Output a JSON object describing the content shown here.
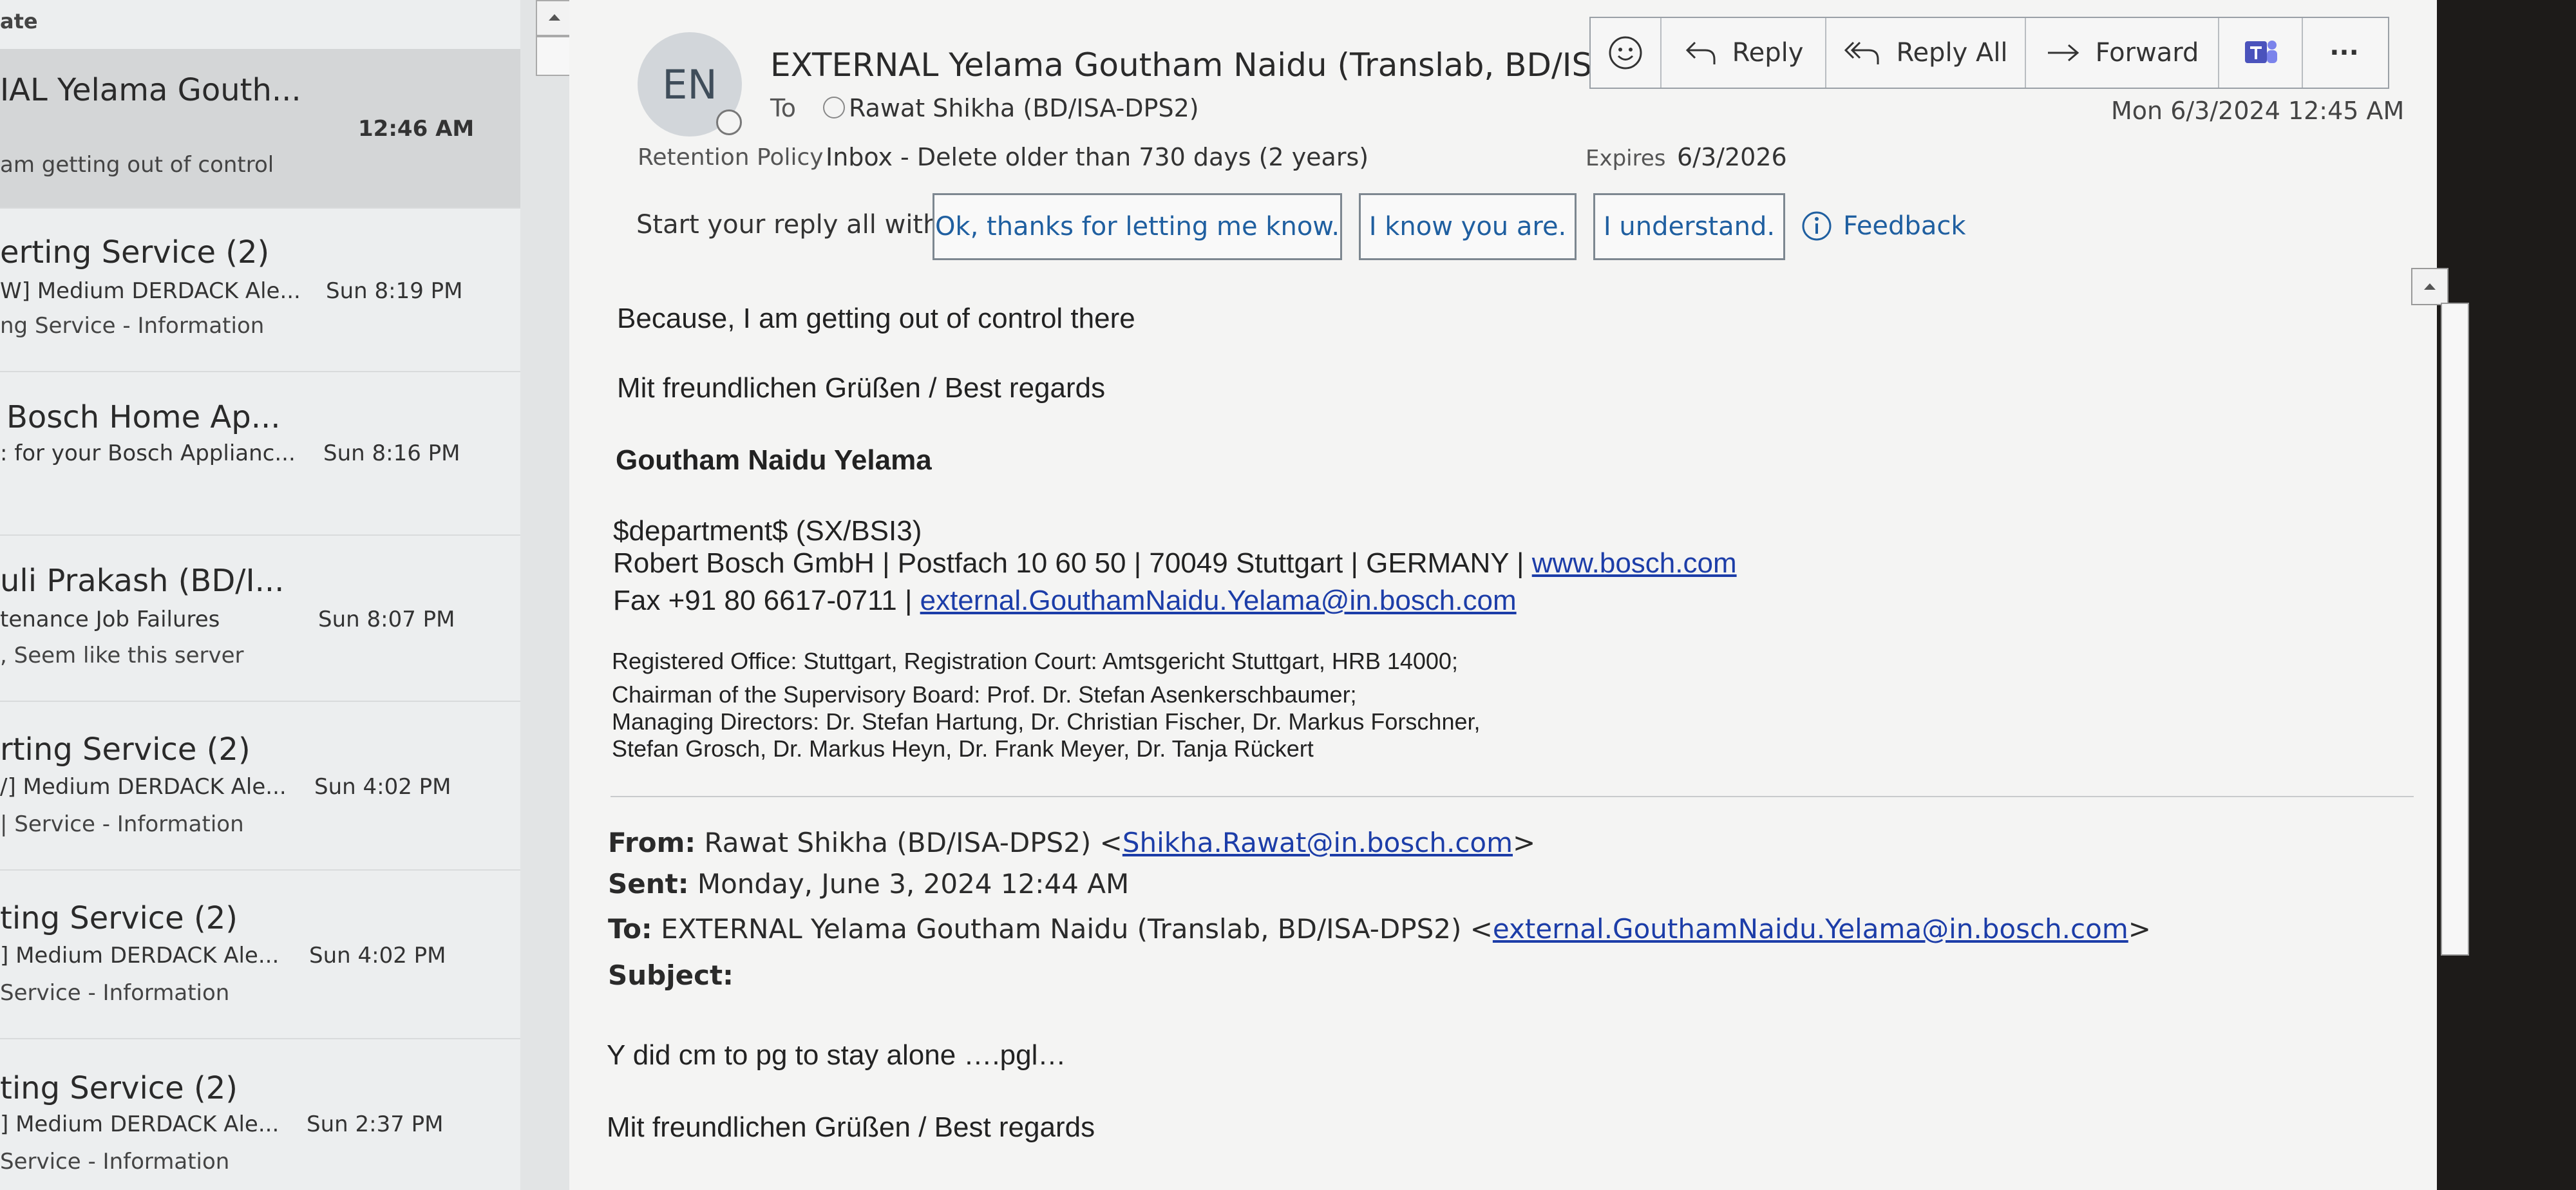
{
  "message_list": {
    "header": "ate",
    "items": [
      {
        "sender": "IAL Yelama Gouth...",
        "subject": "",
        "time": "12:46 AM",
        "preview": "am getting out of control",
        "selected": true
      },
      {
        "sender": "erting Service (2)",
        "subject": "W] Medium DERDACK Ale...",
        "time": "Sun 8:19 PM",
        "preview": "ng Service - Information"
      },
      {
        "sender": "Bosch Home Ap...",
        "subject": ": for your Bosch Applianc...",
        "time": "Sun 8:16 PM",
        "preview": ""
      },
      {
        "sender": "uli Prakash (BD/I...",
        "subject": "tenance Job Failures",
        "time": "Sun 8:07 PM",
        "preview": ", Seem like this server"
      },
      {
        "sender": "rting Service (2)",
        "subject": "/] Medium DERDACK Ale...",
        "time": "Sun 4:02 PM",
        "preview": "| Service - Information"
      },
      {
        "sender": "ting Service (2)",
        "subject": "] Medium DERDACK Ale...",
        "time": "Sun 4:02 PM",
        "preview": " Service - Information"
      },
      {
        "sender": "ting Service (2)",
        "subject": "] Medium DERDACK Ale...",
        "time": "Sun 2:37 PM",
        "preview": "Service - Information"
      }
    ]
  },
  "email": {
    "avatar_initials": "EN",
    "sender": "EXTERNAL Yelama Goutham Naidu (Translab, BD/ISA-",
    "to_label": "To",
    "to_value": "Rawat Shikha (BD/ISA-DPS2)",
    "date": "Mon 6/3/2024 12:45 AM",
    "retention_label": "Retention Policy",
    "retention_value": "Inbox - Delete older than 730 days (2 years)",
    "expires_label": "Expires",
    "expires_value": "6/3/2026"
  },
  "toolbar": {
    "reply": "Reply",
    "reply_all": "Reply All",
    "forward": "Forward",
    "more": "···"
  },
  "suggestions": {
    "label": "Start your reply all with:",
    "items": [
      "Ok, thanks for letting me know.",
      "I know you are.",
      "I understand."
    ],
    "feedback": "Feedback"
  },
  "body": {
    "line1": "Because, I am getting out of control there",
    "regards1": "Mit freundlichen Grüßen / Best regards",
    "sig_name": "Goutham Naidu Yelama",
    "sig_dept": "$department$ (SX/BSI3)",
    "sig_company": "Robert Bosch GmbH | Postfach 10 60 50 | 70049 Stuttgart | GERMANY | ",
    "sig_web": "www.bosch.com",
    "sig_fax": "Fax +91 80 6617-0711 | ",
    "sig_email": "external.GouthamNaidu.Yelama@in.bosch.com",
    "legal1": "Registered Office: Stuttgart, Registration Court: Amtsgericht Stuttgart, HRB 14000;",
    "legal2": "Chairman of the Supervisory Board: Prof. Dr. Stefan Asenkerschbaumer;",
    "legal3": "Managing Directors: Dr. Stefan Hartung, Dr. Christian Fischer, Dr. Markus Forschner,",
    "legal4": "Stefan Grosch, Dr. Markus Heyn, Dr. Frank Meyer, Dr. Tanja Rückert"
  },
  "quoted": {
    "from_label": "From:",
    "from_value": "Rawat Shikha (BD/ISA-DPS2) <",
    "from_email": "Shikha.Rawat@in.bosch.com",
    "from_close": ">",
    "sent_label": "Sent:",
    "sent_value": "Monday, June 3, 2024 12:44 AM",
    "to_label": "To:",
    "to_value": "EXTERNAL Yelama Goutham Naidu (Translab, BD/ISA-DPS2) <",
    "to_email": "external.GouthamNaidu.Yelama@in.bosch.com",
    "to_close": ">",
    "subject_label": "Subject:",
    "subject_value": "",
    "body": "Y did cm to pg to stay alone ….pgl…",
    "regards": "Mit freundlichen Grüßen / Best regards"
  }
}
